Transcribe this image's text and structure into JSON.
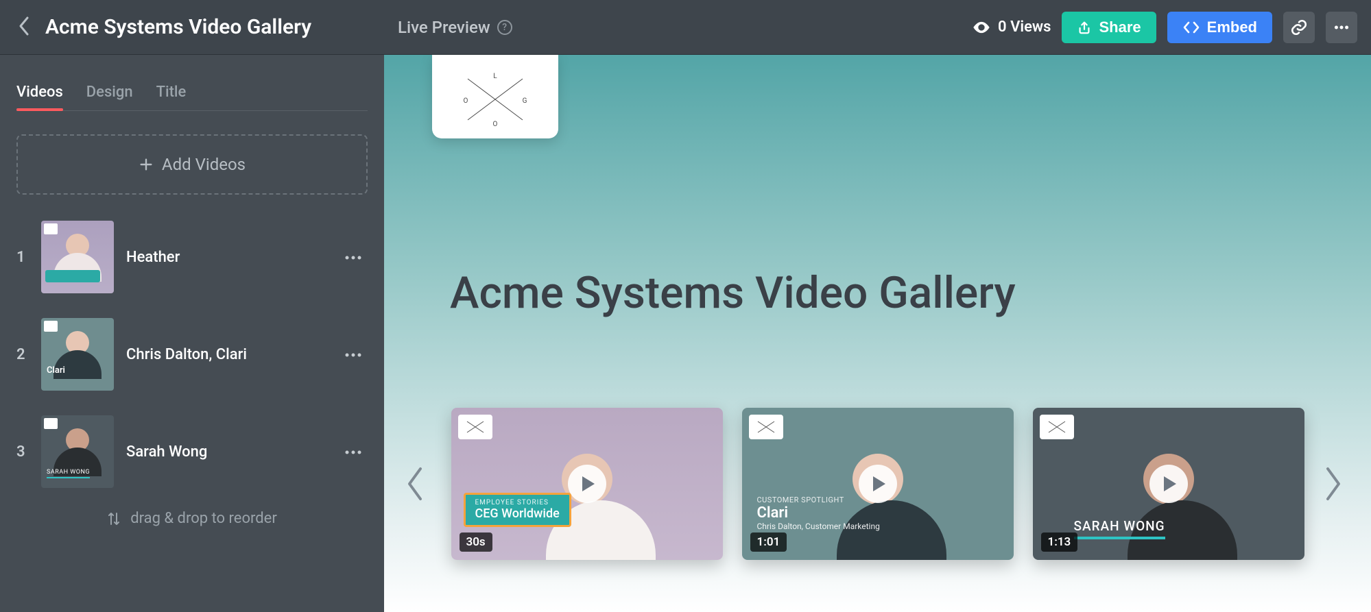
{
  "header": {
    "title": "Acme Systems Video Gallery",
    "live_preview_label": "Live Preview",
    "views_text": "0 Views",
    "share_label": "Share",
    "embed_label": "Embed"
  },
  "tabs": {
    "videos": "Videos",
    "design": "Design",
    "title": "Title"
  },
  "add_videos_label": "Add Videos",
  "reorder_hint": "drag & drop to reorder",
  "videos": [
    {
      "index": "1",
      "name": "Heather"
    },
    {
      "index": "2",
      "name": "Chris Dalton, Clari"
    },
    {
      "index": "3",
      "name": "Sarah Wong"
    }
  ],
  "preview": {
    "title": "Acme Systems Video Gallery",
    "cards": [
      {
        "duration": "30s",
        "overlay_small": "EMPLOYEE STORIES",
        "overlay_large": "CEG Worldwide"
      },
      {
        "duration": "1:01",
        "cap_small": "CUSTOMER SPOTLIGHT",
        "cap_large": "Clari",
        "cap_sub": "Chris Dalton, Customer Marketing"
      },
      {
        "duration": "1:13",
        "name": "SARAH WONG"
      }
    ]
  }
}
